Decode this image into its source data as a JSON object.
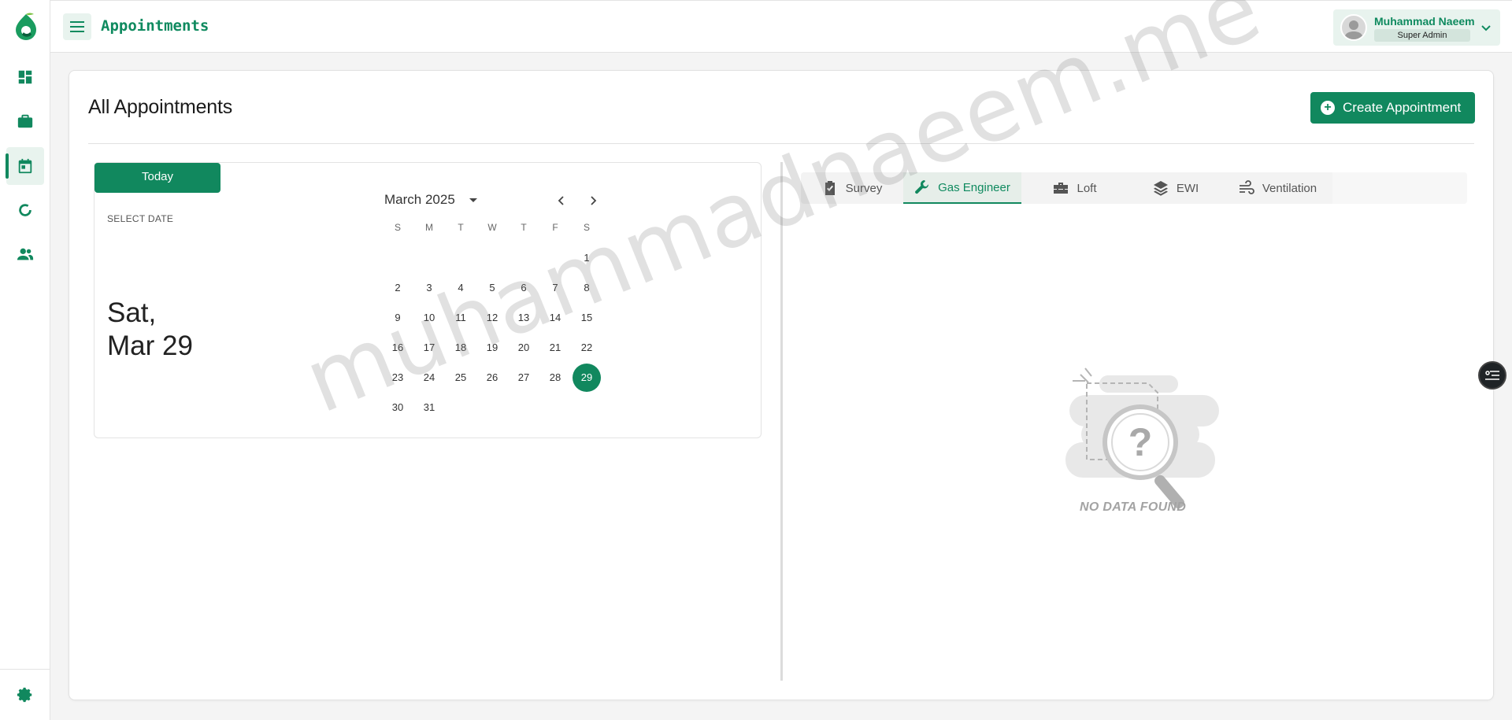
{
  "header": {
    "title": "Appointments",
    "user_name": "Muhammad Naeem",
    "user_role": "Super Admin"
  },
  "sidebar": {
    "items": [
      {
        "icon": "dashboard-icon"
      },
      {
        "icon": "briefcase-icon"
      },
      {
        "icon": "calendar-icon",
        "active": true
      },
      {
        "icon": "refresh-icon"
      },
      {
        "icon": "users-icon"
      }
    ],
    "bottom_icon": "settings-icon"
  },
  "main": {
    "title": "All Appointments",
    "create_button": "Create Appointment"
  },
  "calendar": {
    "today_button": "Today",
    "select_date_label": "SELECT DATE",
    "selected_day_line1": "Sat,",
    "selected_day_line2": "Mar 29",
    "month_label": "March 2025",
    "weekdays": [
      "S",
      "M",
      "T",
      "W",
      "T",
      "F",
      "S"
    ],
    "weeks": [
      [
        "",
        "",
        "",
        "",
        "",
        "",
        "1"
      ],
      [
        "2",
        "3",
        "4",
        "5",
        "6",
        "7",
        "8"
      ],
      [
        "9",
        "10",
        "11",
        "12",
        "13",
        "14",
        "15"
      ],
      [
        "16",
        "17",
        "18",
        "19",
        "20",
        "21",
        "22"
      ],
      [
        "23",
        "24",
        "25",
        "26",
        "27",
        "28",
        "29"
      ],
      [
        "30",
        "31",
        "",
        "",
        "",
        "",
        ""
      ]
    ],
    "selected_day": "29"
  },
  "tabs": [
    {
      "label": "Survey",
      "icon": "clipboard-check-icon"
    },
    {
      "label": "Gas Engineer",
      "icon": "wrench-icon",
      "active": true
    },
    {
      "label": "Loft",
      "icon": "toolbox-icon"
    },
    {
      "label": "EWI",
      "icon": "layers-icon"
    },
    {
      "label": "Ventilation",
      "icon": "wind-icon"
    }
  ],
  "empty_state": {
    "text": "NO DATA FOUND"
  },
  "watermark": "muhammadnaeem.me",
  "colors": {
    "accent": "#11885e",
    "accent_light": "#e8f3ee"
  }
}
